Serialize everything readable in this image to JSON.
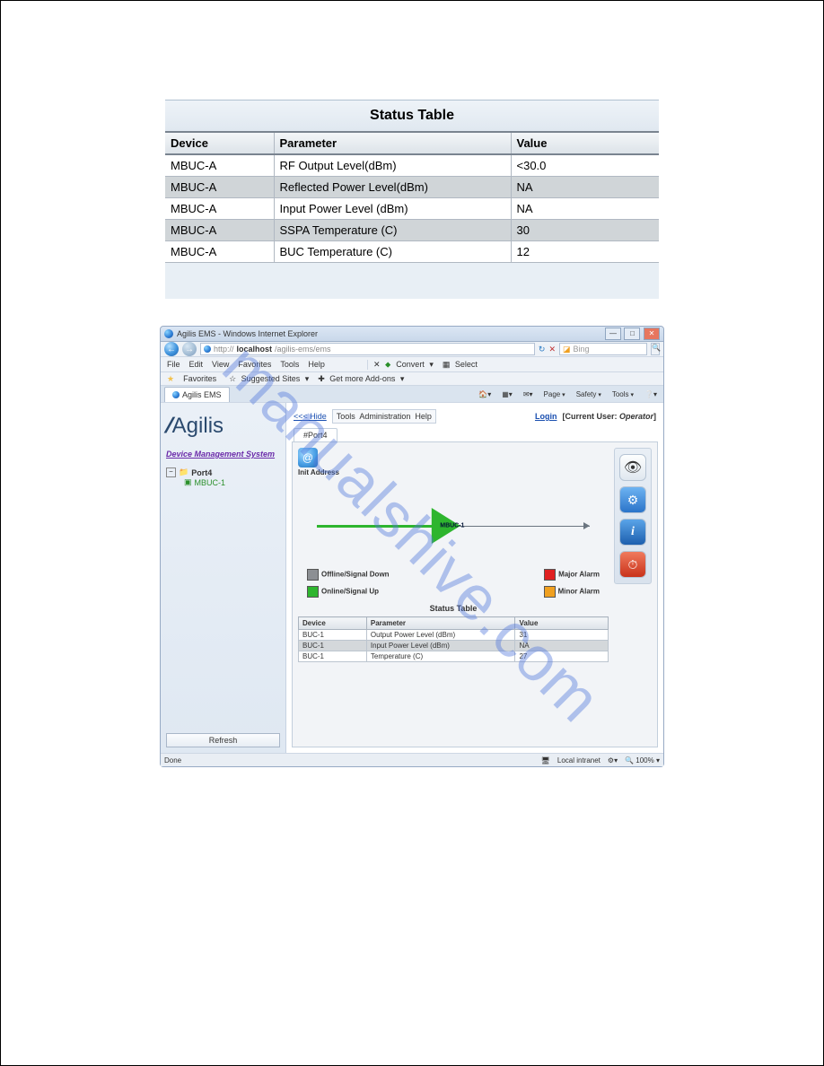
{
  "upper_table": {
    "title": "Status Table",
    "headers": {
      "device": "Device",
      "parameter": "Parameter",
      "value": "Value"
    },
    "rows": [
      {
        "device": "MBUC-A",
        "parameter": "RF Output Level(dBm)",
        "value": "<30.0"
      },
      {
        "device": "MBUC-A",
        "parameter": "Reflected Power Level(dBm)",
        "value": "NA"
      },
      {
        "device": "MBUC-A",
        "parameter": "Input Power Level (dBm)",
        "value": "NA"
      },
      {
        "device": "MBUC-A",
        "parameter": "SSPA Temperature (C)",
        "value": "30"
      },
      {
        "device": "MBUC-A",
        "parameter": "BUC Temperature (C)",
        "value": "12"
      }
    ]
  },
  "browser": {
    "title": "Agilis EMS - Windows Internet Explorer",
    "url_prefix": "http://",
    "url_host": "localhost",
    "url_rest": "/agilis-ems/ems",
    "search_placeholder": "Bing",
    "menus": {
      "file": "File",
      "edit": "Edit",
      "view": "View",
      "favorites": "Favorites",
      "tools": "Tools",
      "help": "Help"
    },
    "extras": {
      "convert": "Convert",
      "select": "Select"
    },
    "favbar": {
      "favorites": "Favorites",
      "suggested": "Suggested Sites",
      "addons": "Get more Add-ons"
    },
    "tab_title": "Agilis EMS",
    "tools": {
      "page": "Page",
      "safety": "Safety",
      "tools": "Tools"
    }
  },
  "sidebar": {
    "logo": "Agilis",
    "dms": "Device Management System",
    "tree": {
      "port_label": "Port4",
      "device_label": "MBUC-1"
    },
    "refresh": "Refresh"
  },
  "main": {
    "hide": "<<< Hide",
    "menu": {
      "tools": "Tools",
      "admin": "Administration",
      "help": "Help"
    },
    "login": "Login",
    "user_label": "[Current User: ",
    "user_value": "Operator",
    "user_close": "]",
    "tab": "#Port4",
    "init_addr": "Init Address",
    "amp_label": "MBUC-1",
    "legend": {
      "offline": "Offline/Signal Down",
      "online": "Online/Signal Up",
      "major": "Major Alarm",
      "minor": "Minor Alarm"
    }
  },
  "small_table": {
    "title": "Status Table",
    "headers": {
      "device": "Device",
      "parameter": "Parameter",
      "value": "Value"
    },
    "rows": [
      {
        "device": "BUC-1",
        "parameter": "Output Power Level (dBm)",
        "value": "31"
      },
      {
        "device": "BUC-1",
        "parameter": "Input Power Level (dBm)",
        "value": "NA"
      },
      {
        "device": "BUC-1",
        "parameter": "Temperature (C)",
        "value": "27"
      }
    ]
  },
  "statusbar": {
    "done": "Done",
    "zone": "Local intranet",
    "zoom": "100%"
  },
  "watermark": "manualshive.com"
}
